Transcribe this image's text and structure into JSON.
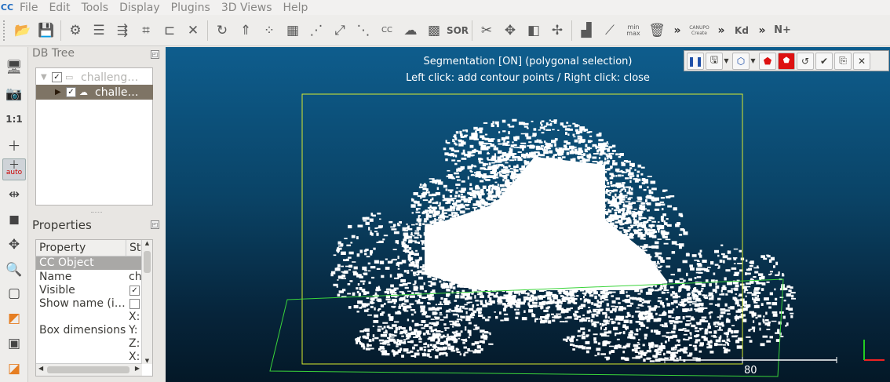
{
  "app": {
    "logo": "CC"
  },
  "menubar": {
    "items": [
      "File",
      "Edit",
      "Tools",
      "Display",
      "Plugins",
      "3D Views",
      "Help"
    ]
  },
  "toolbar": {
    "icons": [
      "open-icon",
      "save-icon",
      "gear-icon",
      "list-icon",
      "merge-icon",
      "crop-icon",
      "segment-icon",
      "close-icon",
      "translate-icon",
      "normals-icon",
      "sample-icon",
      "mesh-icon",
      "scatter-icon",
      "scale-icon",
      "subsample-icon",
      "cloud-compare-icon",
      "density-icon",
      "checker-icon",
      "sor-icon",
      "scissors-icon",
      "move-icon",
      "plane-icon",
      "register-icon",
      "histogram-icon",
      "curve-icon",
      "minmax-icon",
      "trash-icon"
    ],
    "labels": {
      "cc": "CC",
      "sor": "SOR",
      "minmax": "min max",
      "canupo": "CANUPO Create",
      "kd": "Kd",
      "more": "»",
      "n_plus": "N+"
    }
  },
  "lefttools": {
    "ratio": "1:1",
    "auto": "auto"
  },
  "dbtree": {
    "title": "DB Tree",
    "rows": [
      {
        "label": "challeng…",
        "checked": "✓",
        "expanded": "▼",
        "selected": false
      },
      {
        "label": "challe…",
        "checked": "✓",
        "expanded": "▶",
        "selected": true
      }
    ]
  },
  "properties": {
    "title": "Properties",
    "headers": [
      "Property",
      "Sta"
    ],
    "section": "CC Object",
    "rows": [
      {
        "name": "Name",
        "value": "ch"
      },
      {
        "name": "Visible",
        "value": "✓"
      },
      {
        "name": "Show name (i…",
        "value": ""
      },
      {
        "name": "Box dimensions",
        "value": "X:\nY:\nZ:\nX:"
      }
    ],
    "box_axes": [
      "X:",
      "Y:",
      "Z:",
      "X:"
    ]
  },
  "viewport": {
    "seg_status": "Segmentation [ON] (polygonal selection)",
    "seg_hint": "Left click: add contour points / Right click: close",
    "scale_value": "80",
    "colors": {
      "bbox": "#d8ea2e",
      "ground_plane": "#3ad43a",
      "axis_x": "#e22222",
      "axis_y": "#22cc22"
    }
  },
  "seg_toolbar": {
    "icons": [
      "pause-icon",
      "save-icon",
      "polygon-icon",
      "inside-icon",
      "outside-icon",
      "reset-icon",
      "confirm-icon",
      "export-icon",
      "close-icon"
    ]
  }
}
